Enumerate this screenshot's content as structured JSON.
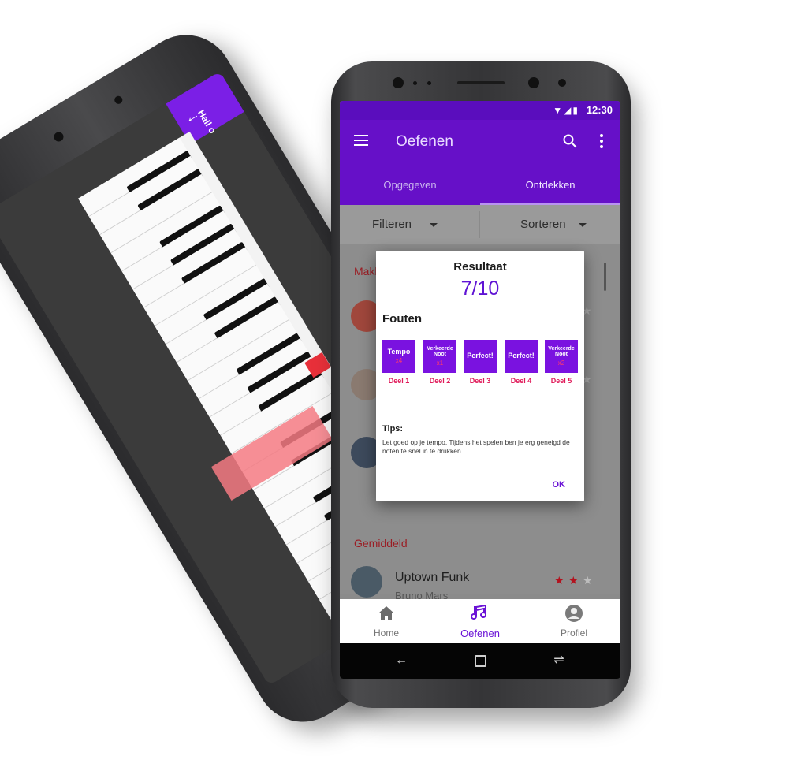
{
  "status_bar": {
    "time": "12:30",
    "icons": "▼◢▮"
  },
  "app_bar": {
    "title": "Oefenen"
  },
  "tabs": [
    {
      "label": "Opgegeven"
    },
    {
      "label": "Ontdekken"
    }
  ],
  "filter": {
    "filter_label": "Filteren",
    "sort_label": "Sorteren"
  },
  "sections": {
    "first_partial": "Makk",
    "second": "Gemiddeld"
  },
  "songs": [
    {
      "title": "Uptown Funk",
      "artist": "Bruno Mars",
      "rating": 2,
      "max": 3
    }
  ],
  "dialog": {
    "title": "Resultaat",
    "score": "7/10",
    "errors_label": "Fouten",
    "parts": [
      {
        "label": "Tempo",
        "count": "x4",
        "name": "Deel 1"
      },
      {
        "label": "Verkeerde Noot",
        "count": "x1",
        "name": "Deel 2"
      },
      {
        "label": "Perfect!",
        "count": "",
        "name": "Deel 3"
      },
      {
        "label": "Perfect!",
        "count": "",
        "name": "Deel 4"
      },
      {
        "label": "Verkeerde Noot",
        "count": "x2",
        "name": "Deel 5"
      }
    ],
    "tips_label": "Tips:",
    "tips_text": "Let goed op je tempo. Tijdens het spelen ben je erg geneigd de noten té snel in te drukken.",
    "ok_label": "OK"
  },
  "bottom_nav": [
    {
      "label": "Home",
      "icon": "home-icon"
    },
    {
      "label": "Oefenen",
      "icon": "music-note-icon"
    },
    {
      "label": "Profiel",
      "icon": "profile-icon"
    }
  ],
  "back_phone": {
    "header_partial": "Hall o"
  },
  "colors": {
    "primary": "#6610c8",
    "accent": "#7a12e0",
    "error_red": "#e01b5a",
    "section_red": "#9b1d24"
  }
}
